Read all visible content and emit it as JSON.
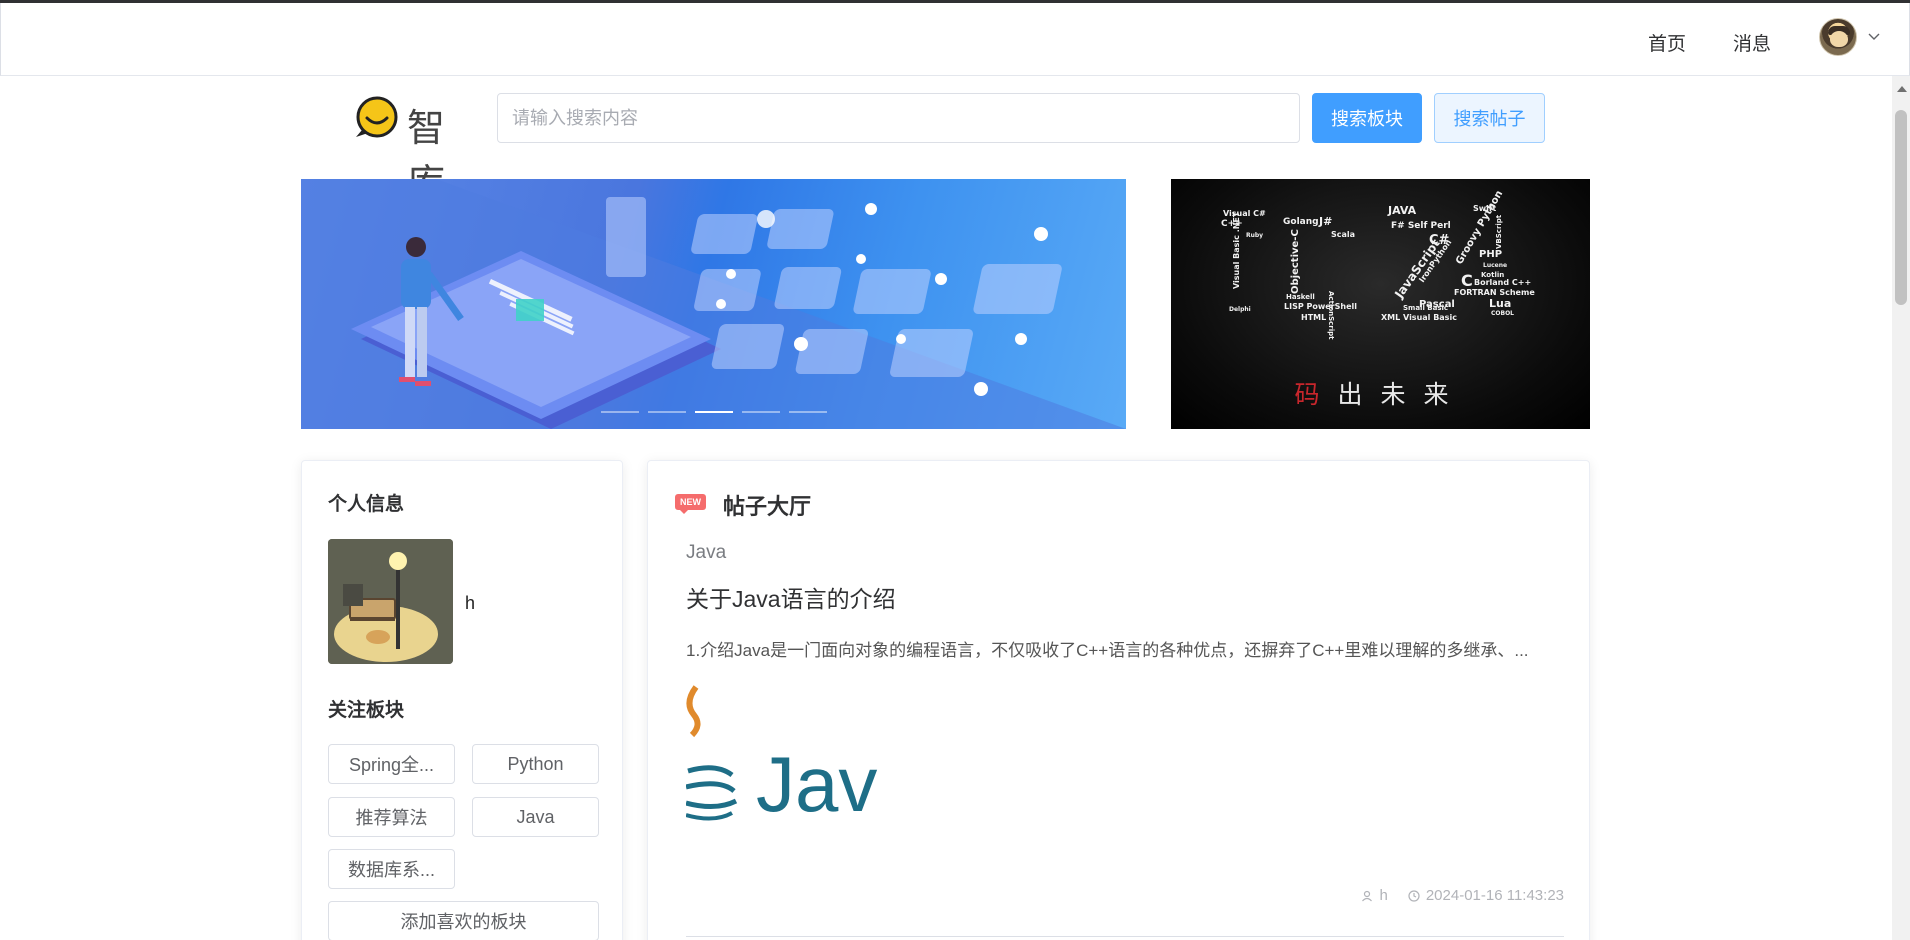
{
  "header": {
    "nav_home": "首页",
    "nav_messages": "消息"
  },
  "logo": {
    "text": "智库"
  },
  "search": {
    "placeholder": "请输入搜索内容",
    "value": "",
    "board_button": "搜索板块",
    "post_button": "搜索帖子"
  },
  "carousel": {
    "slide_count": 5,
    "active_index": 2
  },
  "side_banner": {
    "slogan_first": "码",
    "slogan_rest": "出未来"
  },
  "profile": {
    "title": "个人信息",
    "username": "h",
    "follow_title": "关注板块",
    "followed_boards": [
      "Spring全...",
      "Python",
      "推荐算法",
      "Java",
      "数据库系..."
    ],
    "add_button": "添加喜欢的板块"
  },
  "hall": {
    "badge": "NEW",
    "title": "帖子大厅",
    "post": {
      "board": "Java",
      "title": "关于Java语言的介绍",
      "description": "1.介绍Java是一门面向对象的编程语言，不仅吸收了C++语言的各种优点，还摒弃了C++里难以理解的多继承、...",
      "image_text": "Jav",
      "author": "h",
      "time": "2024-01-16 11:43:23"
    }
  },
  "colors": {
    "primary": "#409eff",
    "primary_light": "#ecf5ff",
    "badge_red": "#f56c6c",
    "logo_yellow": "#f5c518",
    "java_teal": "#1e6e87",
    "java_orange": "#e08a2c"
  },
  "icons": {
    "user_meta": "user-icon",
    "time_meta": "clock-icon",
    "dropdown": "chevron-down-icon"
  }
}
